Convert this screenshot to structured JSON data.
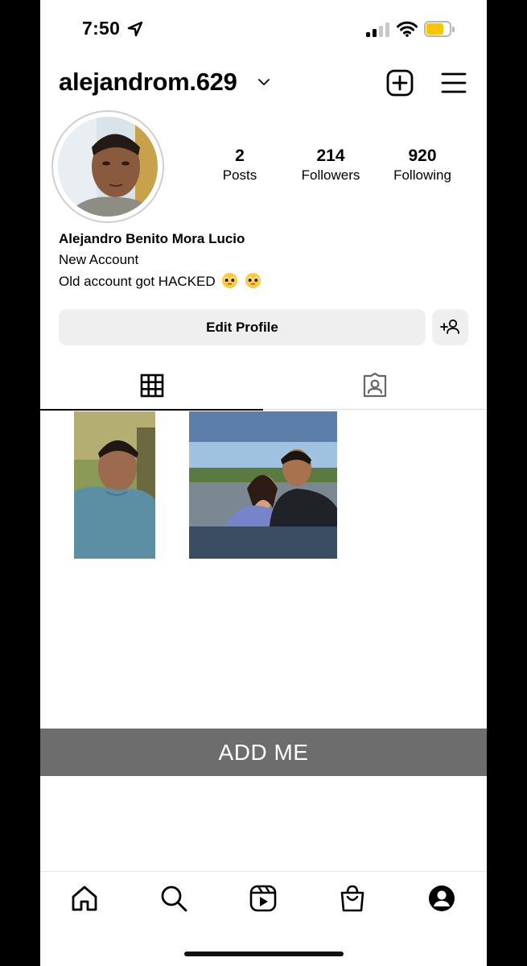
{
  "status_bar": {
    "time": "7:50"
  },
  "header": {
    "username": "alejandrom.629"
  },
  "profile": {
    "stats": [
      {
        "value": "2",
        "label": "Posts"
      },
      {
        "value": "214",
        "label": "Followers"
      },
      {
        "value": "920",
        "label": "Following"
      }
    ],
    "full_name": "Alejandro Benito Mora Lucio",
    "bio_line1": "New Account",
    "bio_line2": "Old account got HACKED"
  },
  "actions": {
    "edit_profile_label": "Edit Profile"
  },
  "tabs": [
    {
      "icon": "grid-icon",
      "active": true
    },
    {
      "icon": "tagged-icon",
      "active": false
    }
  ],
  "posts": [
    {
      "icon": "photo"
    },
    {
      "icon": "photo"
    }
  ],
  "banner": {
    "text": "ADD ME"
  },
  "bottom_nav": [
    {
      "icon": "home-icon"
    },
    {
      "icon": "search-icon"
    },
    {
      "icon": "reels-icon"
    },
    {
      "icon": "shop-icon"
    },
    {
      "icon": "profile-icon"
    }
  ],
  "colors": {
    "battery": "#f7c600",
    "button_bg": "#efefef",
    "banner_bg": "#6d6d6d"
  }
}
